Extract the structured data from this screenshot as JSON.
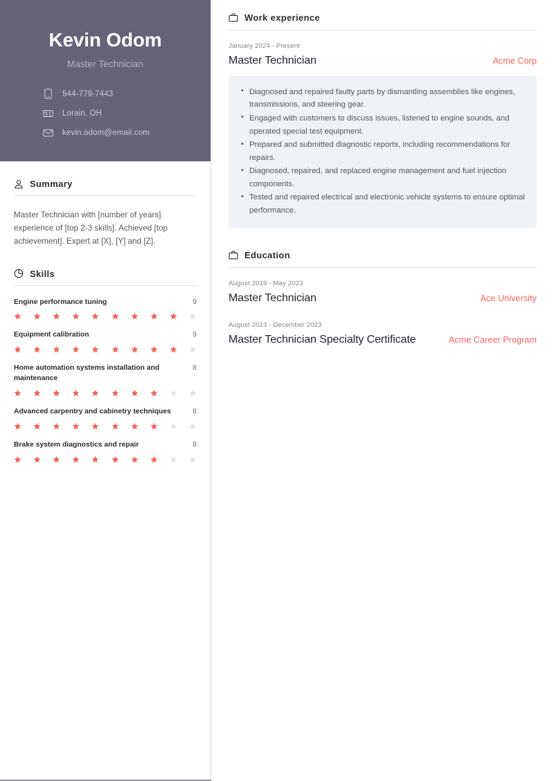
{
  "theme": {
    "header_bg": "#66627a",
    "accent": "#f4635c",
    "card_bg": "#eff2f6",
    "text_dark": "#242430",
    "text_muted": "#55535f"
  },
  "profile": {
    "name": "Kevin Odom",
    "job_title": "Master Technician",
    "contacts": [
      {
        "icon": "phone-icon",
        "value": "544-779-7443"
      },
      {
        "icon": "location-icon",
        "value": "Lorain, OH"
      },
      {
        "icon": "email-icon",
        "value": "kevin.odom@email.com"
      }
    ]
  },
  "summary": {
    "icon": "person-icon",
    "title": "Summary",
    "text": "Master Technician with [number of years] experience of [top 2-3 skills]. Achieved [top achievement]. Expert at [X], [Y] and [Z]."
  },
  "skills": {
    "icon": "chart-circle-icon",
    "title": "Skills",
    "max": 10,
    "items": [
      {
        "name": "Engine performance tuning",
        "score": 9
      },
      {
        "name": "Equipment calibration",
        "score": 9
      },
      {
        "name": "Home automation systems installation and maintenance",
        "score": 8
      },
      {
        "name": "Advanced carpentry and cabinetry techniques",
        "score": 8
      },
      {
        "name": "Brake system diagnostics and repair",
        "score": 8
      }
    ]
  },
  "work_experience": {
    "icon": "briefcase-icon",
    "title": "Work experience",
    "entries": [
      {
        "date": "January 2024 - Present",
        "title": "Master Technician",
        "organization": "Acme Corp",
        "bullets": [
          "Diagnosed and repaired faulty parts by dismantling assemblies like engines, transmissions, and steering gear.",
          "Engaged with customers to discuss issues, listened to engine sounds, and operated special test equipment.",
          "Prepared and submitted diagnostic reports, including recommendations for repairs.",
          "Diagnosed, repaired, and replaced engine management and fuel injection components.",
          "Tested and repaired electrical and electronic vehicle systems to ensure optimal performance."
        ]
      }
    ]
  },
  "education": {
    "icon": "briefcase-icon",
    "title": "Education",
    "entries": [
      {
        "date": "August 2019 - May 2023",
        "title": "Master Technician",
        "organization": "Ace University"
      },
      {
        "date": "August 2023 - December 2023",
        "title": "Master Technician Specialty Certificate",
        "organization": "Acme Career Program"
      }
    ]
  }
}
